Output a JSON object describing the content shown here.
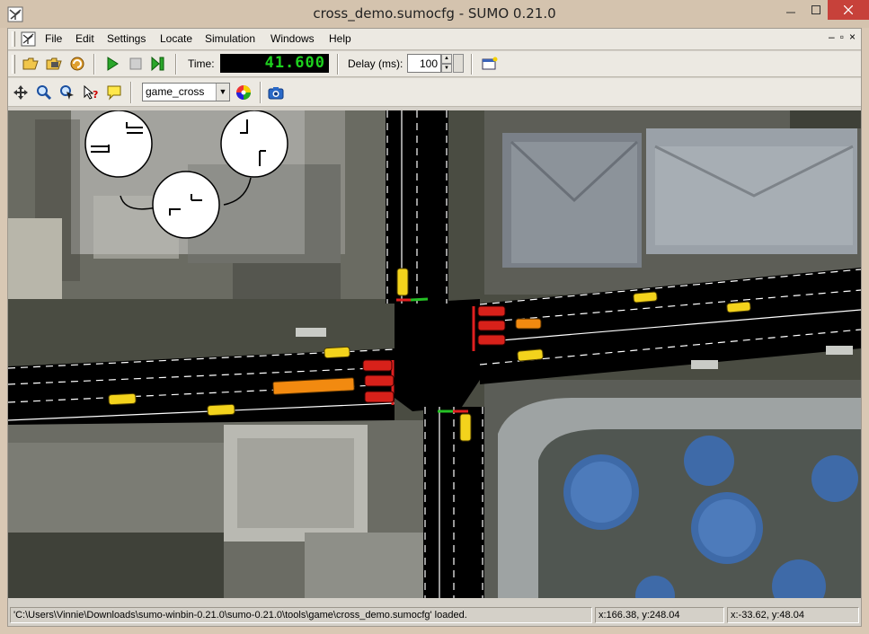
{
  "window": {
    "title": "cross_demo.sumocfg - SUMO 0.21.0"
  },
  "menu": {
    "items": [
      {
        "label": "File",
        "name": "menu-file"
      },
      {
        "label": "Edit",
        "name": "menu-edit"
      },
      {
        "label": "Settings",
        "name": "menu-settings"
      },
      {
        "label": "Locate",
        "name": "menu-locate"
      },
      {
        "label": "Simulation",
        "name": "menu-simulation"
      },
      {
        "label": "Windows",
        "name": "menu-windows"
      },
      {
        "label": "Help",
        "name": "menu-help"
      }
    ],
    "mdi_buttons": [
      "–",
      "▫",
      "×"
    ]
  },
  "toolbar": {
    "time_label": "Time:",
    "time_value": "41.600",
    "delay_label": "Delay (ms):",
    "delay_value": "100",
    "view_select": "game_cross"
  },
  "status": {
    "message": "'C:\\Users\\Vinnie\\Downloads\\sumo-winbin-0.21.0\\sumo-0.21.0\\tools\\game\\cross_demo.sumocfg' loaded.",
    "coord1": "x:166.38, y:248.04",
    "coord2": "x:-33.62, y:48.04"
  },
  "colors": {
    "lcd_text": "#1ed21e",
    "close_button": "#c7413a",
    "vehicle_yellow": "#f3d31c",
    "vehicle_red": "#d8211a",
    "vehicle_orange": "#f28a10"
  },
  "icons": {
    "toolbar1": [
      "open-icon",
      "open-network-icon",
      "reload-icon",
      "play-icon",
      "stop-icon",
      "step-icon",
      "new-view-icon"
    ],
    "toolbar2": [
      "recenter-icon",
      "zoom-icon",
      "locate-icon",
      "help-icon",
      "tooltip-icon",
      "color-wheel-icon",
      "screenshot-icon"
    ]
  }
}
